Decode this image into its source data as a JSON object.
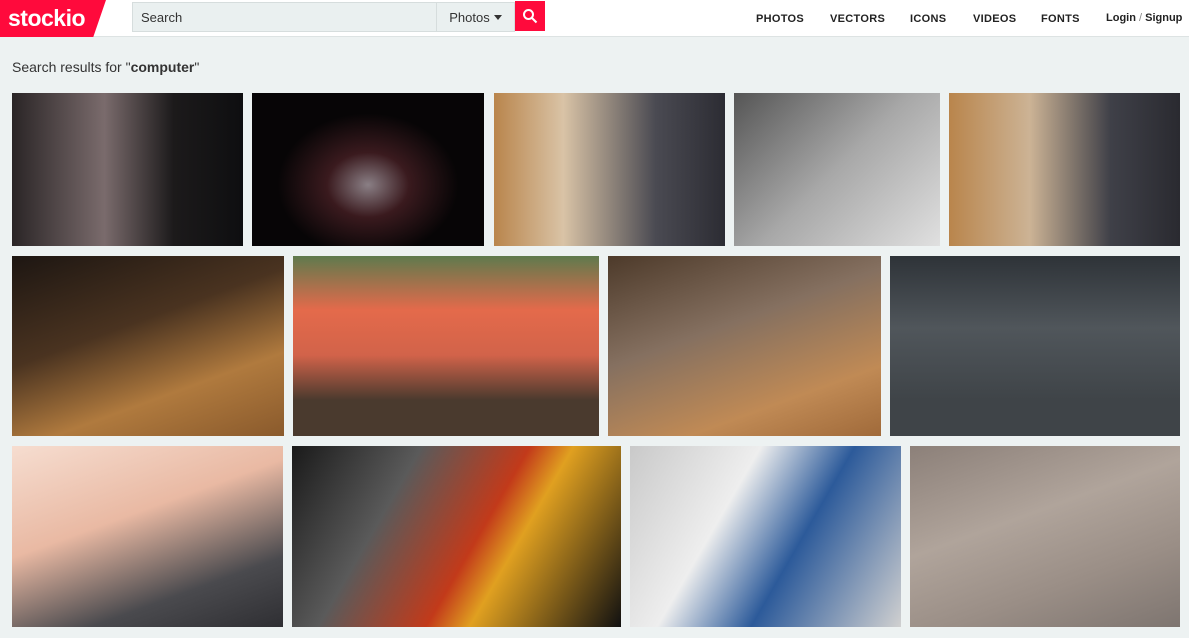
{
  "header": {
    "logo": "stockio",
    "search_placeholder": "Search",
    "search_type": "Photos",
    "nav": [
      "PHOTOS",
      "VECTORS",
      "ICONS",
      "VIDEOS",
      "FONTS"
    ],
    "login": "Login",
    "signup": "Signup",
    "separator": "/"
  },
  "results": {
    "prefix": "Search results for \"",
    "query": "computer",
    "suffix": "\""
  },
  "colors": {
    "brand": "#ff0a3c"
  },
  "images": [
    {
      "subject": "desk-by-window",
      "bg": "linear-gradient(90deg,#2a2526,#7a6b6c 40%,#1c1a1b 70%,#0e0e10)"
    },
    {
      "subject": "laptop-dark",
      "bg": "radial-gradient(ellipse at 50% 60%,#8a7f85 0,#3a1a1e 25%,#070506 55%)"
    },
    {
      "subject": "man-laptop-wood",
      "bg": "linear-gradient(90deg,#b9854c,#d9c3a6 30%,#4a4a52 70%,#2c2c33)"
    },
    {
      "subject": "keyboard-mug-bw",
      "bg": "linear-gradient(135deg,#555,#a8a8a8 50%,#e0e0e0)"
    },
    {
      "subject": "man-laptop-wood-2",
      "bg": "linear-gradient(90deg,#b9854c,#ccb395 35%,#3f4048 70%,#2a2a30)"
    },
    {
      "subject": "laptop-wooden-table",
      "bg": "linear-gradient(160deg,#1d1612,#4a3320 40%,#b07a3e 70%,#8a5a2c)"
    },
    {
      "subject": "imac-deer",
      "bg": "linear-gradient(180deg,#5f7a4d,#e46a4b 30%,#d2634a 55%,#4a3a2e 80%)"
    },
    {
      "subject": "laptop-blur-table",
      "bg": "linear-gradient(160deg,#4d3a2a,#857060 40%,#c08a55 75%,#a06a3a)"
    },
    {
      "subject": "flatlay-desk",
      "bg": "linear-gradient(180deg,#2e3338,#50565b 40%,#3f4448 80%)"
    },
    {
      "subject": "hands-typing",
      "bg": "linear-gradient(160deg,#f6ddd0,#e9b9a3 40%,#4a4a4e 75%,#2f2f33)"
    },
    {
      "subject": "cables-pc",
      "bg": "linear-gradient(120deg,#1a1a1a,#5a5a5a 30%,#c23a1a 55%,#e0a020 65%,#111)"
    },
    {
      "subject": "network-cabinet",
      "bg": "linear-gradient(120deg,#c9c9c9,#eeeeee 35%,#2c5a9a 60%,#d0d0d0)"
    },
    {
      "subject": "laptop-topview",
      "bg": "linear-gradient(160deg,#8c8079,#b0a49b 40%,#9a8e86 70%,#7e7570)"
    }
  ]
}
